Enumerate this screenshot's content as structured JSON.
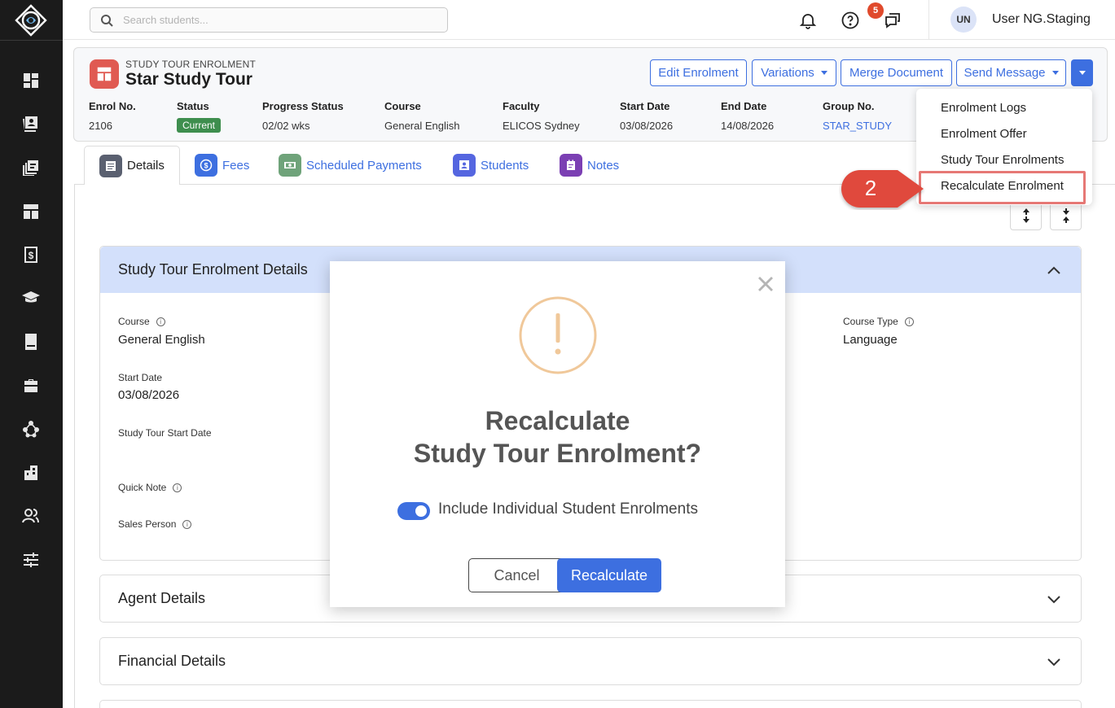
{
  "search": {
    "placeholder": "Search students..."
  },
  "topbar": {
    "notification_count": "5",
    "user_initials": "UN",
    "user_name": "User NG.Staging"
  },
  "header": {
    "subtitle": "STUDY TOUR ENROLMENT",
    "title": "Star Study Tour",
    "buttons": {
      "edit": "Edit Enrolment",
      "variations": "Variations",
      "merge": "Merge Document",
      "send": "Send Message"
    },
    "meta": [
      {
        "label": "Enrol No.",
        "value": "2106"
      },
      {
        "label": "Status",
        "value": "Current"
      },
      {
        "label": "Progress Status",
        "value": "02/02 wks"
      },
      {
        "label": "Course",
        "value": "General English"
      },
      {
        "label": "Faculty",
        "value": "ELICOS Sydney"
      },
      {
        "label": "Start Date",
        "value": "03/08/2026"
      },
      {
        "label": "End Date",
        "value": "14/08/2026"
      },
      {
        "label": "Group No.",
        "value": "STAR_STUDY"
      }
    ]
  },
  "tabs": [
    {
      "label": "Details",
      "color": "#5a6070"
    },
    {
      "label": "Fees",
      "color": "#3d6fe0"
    },
    {
      "label": "Scheduled Payments",
      "color": "#6fa37a"
    },
    {
      "label": "Students",
      "color": "#5566e0"
    },
    {
      "label": "Notes",
      "color": "#7b3fb3"
    }
  ],
  "sections": {
    "details": {
      "title": "Study Tour Enrolment Details",
      "course_label": "Course",
      "course_value": "General English",
      "course_type_label": "Course Type",
      "course_type_value": "Language",
      "start_date_label": "Start Date",
      "start_date_value": "03/08/2026",
      "tour_start_label": "Study Tour Start Date",
      "quick_note_label": "Quick Note",
      "sales_person_label": "Sales Person"
    },
    "agent": {
      "title": "Agent Details"
    },
    "financial": {
      "title": "Financial Details"
    }
  },
  "menu": {
    "items": [
      "Enrolment Logs",
      "Enrolment Offer",
      "Study Tour Enrolments",
      "Recalculate Enrolment"
    ],
    "callout_number": "2"
  },
  "modal": {
    "title_line1": "Recalculate",
    "title_line2": "Study Tour Enrolment?",
    "toggle_label": "Include Individual Student Enrolments",
    "toggle_on": true,
    "cancel_label": "Cancel",
    "confirm_label": "Recalculate"
  },
  "colors": {
    "accent": "#3d6fe0",
    "sidebar": "#1b1b1b",
    "status_current": "#3e8e4e",
    "callout": "#e04a3c",
    "warning": "#f0c89a",
    "section_header": "#d3e0fb"
  }
}
